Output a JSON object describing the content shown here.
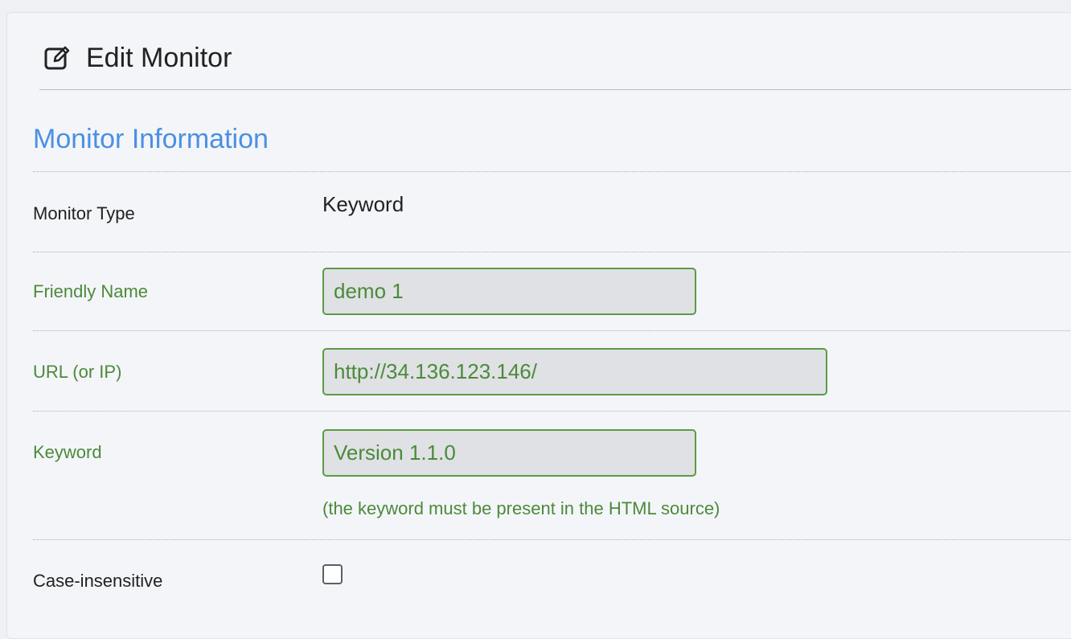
{
  "header": {
    "title": "Edit Monitor",
    "icon": "edit-icon"
  },
  "section": {
    "title": "Monitor Information"
  },
  "fields": {
    "monitor_type": {
      "label": "Monitor Type",
      "value": "Keyword"
    },
    "friendly_name": {
      "label": "Friendly Name",
      "value": "demo 1"
    },
    "url": {
      "label": "URL (or IP)",
      "value": "http://34.136.123.146/"
    },
    "keyword": {
      "label": "Keyword",
      "value": "Version 1.1.0",
      "help": "(the keyword must be present in the HTML source)"
    },
    "case_insensitive": {
      "label": "Case-insensitive",
      "checked": false
    }
  },
  "colors": {
    "accent": "#4a90e2",
    "valid_green": "#4b8a3a",
    "input_bg": "#dfe1e4",
    "panel_bg": "#f4f5f9"
  }
}
